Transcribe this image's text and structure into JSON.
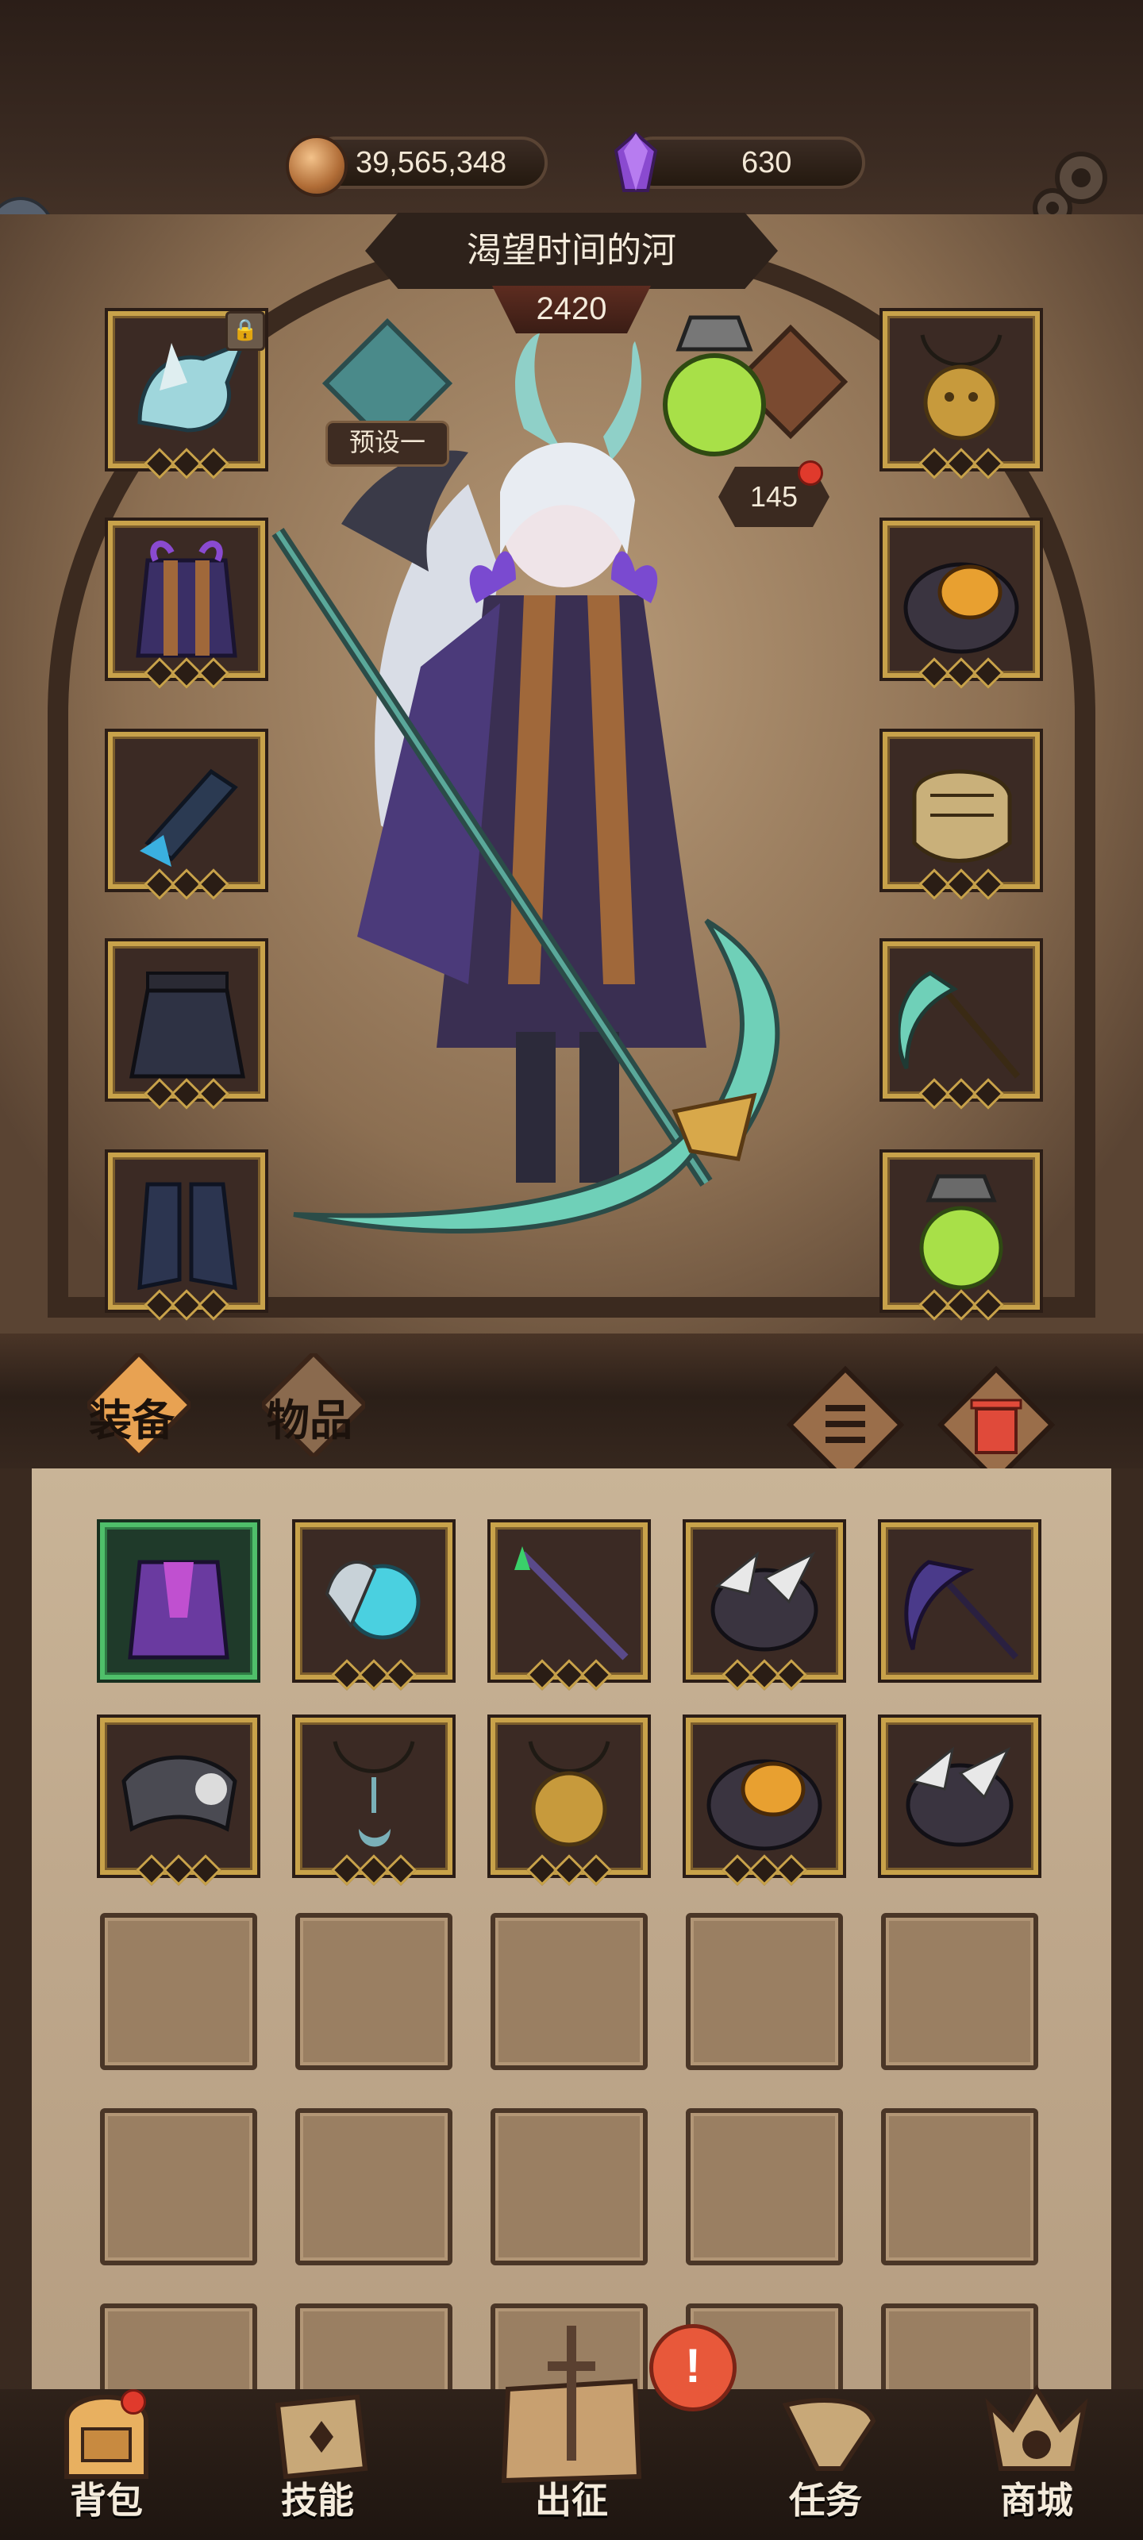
{
  "resources": {
    "coins": "39,565,348",
    "gems": "630"
  },
  "hero": {
    "name": "渴望时间的河",
    "power": "2420",
    "preset_label": "预设一",
    "level": "145"
  },
  "equipment_left": [
    {
      "icon": "horned-helmet-icon",
      "locked": true,
      "lock_glyph": "🔒"
    },
    {
      "icon": "robe-armor-icon"
    },
    {
      "icon": "gauntlet-icon"
    },
    {
      "icon": "skirt-icon"
    },
    {
      "icon": "boots-icon"
    }
  ],
  "equipment_right": [
    {
      "icon": "lion-necklace-icon"
    },
    {
      "icon": "amber-ring-icon"
    },
    {
      "icon": "fist-gauntlet-icon"
    },
    {
      "icon": "scythe-icon"
    },
    {
      "icon": "potion-flask-icon"
    }
  ],
  "tabs": {
    "equipment": "装备",
    "items": "物品"
  },
  "inventory_rows": [
    [
      "purple-robe-icon",
      "dragon-orb-icon",
      "spear-upgrade-icon",
      "feather-ring-icon",
      "dark-scythe-icon"
    ],
    [
      "skull-belt-icon",
      "moon-pendant-icon",
      "lion-necklace-icon",
      "amber-ring-icon",
      "feather-ring-icon"
    ]
  ],
  "bottom_nav": [
    {
      "label": "背包",
      "icon": "backpack-icon"
    },
    {
      "label": "技能",
      "icon": "skill-book-icon"
    },
    {
      "label": "出征",
      "icon": "map-sword-icon"
    },
    {
      "label": "任务",
      "icon": "horn-icon"
    },
    {
      "label": "商城",
      "icon": "shop-crown-icon"
    }
  ],
  "alert_glyph": "!",
  "colors": {
    "gold_frame": "#c8a24a",
    "green_frame": "#4fbf6a",
    "panel": "#bda68a"
  }
}
